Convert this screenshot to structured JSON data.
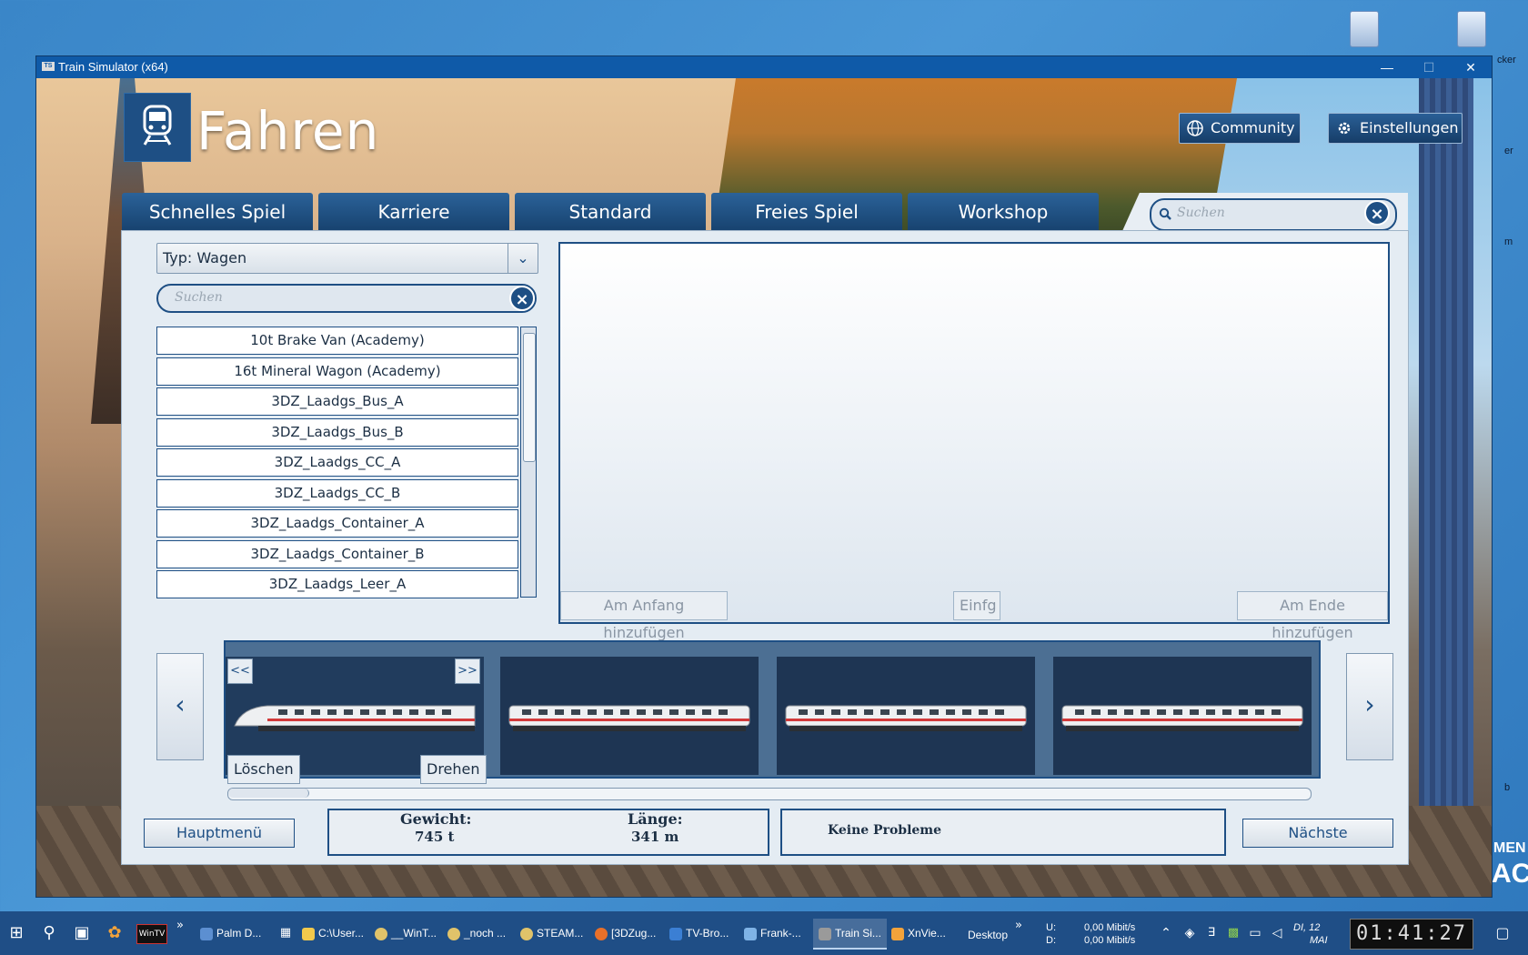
{
  "desktop": {
    "edge_texts": [
      "cker",
      "er",
      "m",
      "b",
      "MEN",
      "AC"
    ]
  },
  "window": {
    "title": "Train Simulator (x64)",
    "app_badge": "TS",
    "controls": {
      "minimize": "—",
      "maximize": "☐",
      "close": "✕"
    }
  },
  "header": {
    "title": "Fahren",
    "community": "Community",
    "settings": "Einstellungen"
  },
  "tabs": [
    "Schnelles Spiel",
    "Karriere",
    "Standard",
    "Freies Spiel",
    "Workshop"
  ],
  "top_search": {
    "placeholder": "Suchen"
  },
  "filter": {
    "type_label": "Typ: Wagen"
  },
  "list_search": {
    "placeholder": "Suchen"
  },
  "wagons": [
    "10t Brake Van (Academy)",
    "16t Mineral Wagon (Academy)",
    "3DZ_Laadgs_Bus_A",
    "3DZ_Laadgs_Bus_B",
    "3DZ_Laadgs_CC_A",
    "3DZ_Laadgs_CC_B",
    "3DZ_Laadgs_Container_A",
    "3DZ_Laadgs_Container_B",
    "3DZ_Laadgs_Leer_A"
  ],
  "preview_buttons": {
    "add_start": "Am Anfang hinzufügen",
    "insert": "Einfg",
    "add_end": "Am Ende hinzufügen"
  },
  "consist": {
    "prev": "<<",
    "next": ">>",
    "delete": "Löschen",
    "rotate": "Drehen",
    "nav_left": "‹",
    "nav_right": "›"
  },
  "bottom": {
    "main_menu": "Hauptmenü",
    "weight_label": "Gewicht:",
    "weight_value": "745 t",
    "length_label": "Länge:",
    "length_value": "341 m",
    "status": "Keine Probleme",
    "next": "Nächste"
  },
  "taskbar": {
    "items": [
      "Palm D...",
      "C:\\User...",
      "__WinT...",
      "_noch ...",
      "STEAM...",
      "[3DZug...",
      "TV-Bro...",
      "Frank-...",
      "Train Si...",
      "XnVie..."
    ],
    "desktop_label": "Desktop",
    "chevron": "»",
    "net_u_label": "U:",
    "net_d_label": "D:",
    "net_u_value": "0,00 Mibit/s",
    "net_d_value": "0,00 Mibit/s",
    "day": "DI, 12",
    "month": "MAI",
    "clock": "01:41:27",
    "wintv": "WinTV"
  }
}
